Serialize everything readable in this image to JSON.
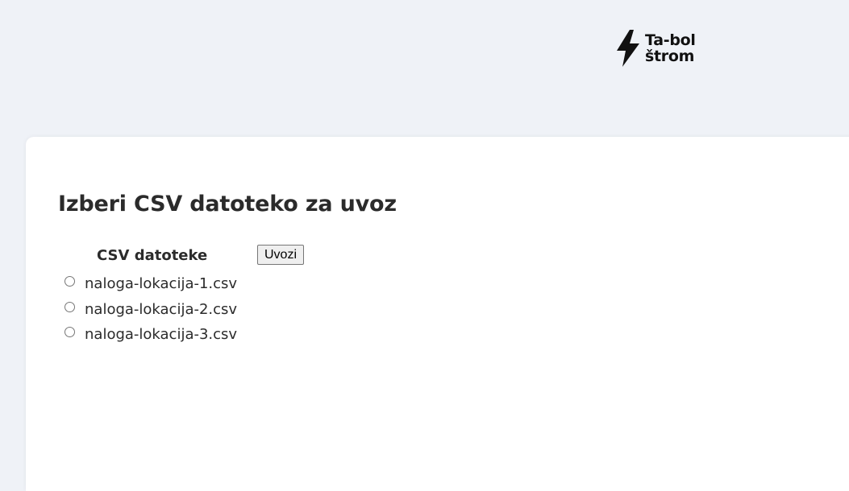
{
  "logo": {
    "line1": "Ta-bol",
    "line2": "štrom"
  },
  "main": {
    "title": "Izberi CSV datoteko za uvoz",
    "column_header": "CSV datoteke",
    "import_button": "Uvozi",
    "files": [
      {
        "name": "naloga-lokacija-1.csv",
        "selected": false
      },
      {
        "name": "naloga-lokacija-2.csv",
        "selected": false
      },
      {
        "name": "naloga-lokacija-3.csv",
        "selected": false
      }
    ]
  }
}
